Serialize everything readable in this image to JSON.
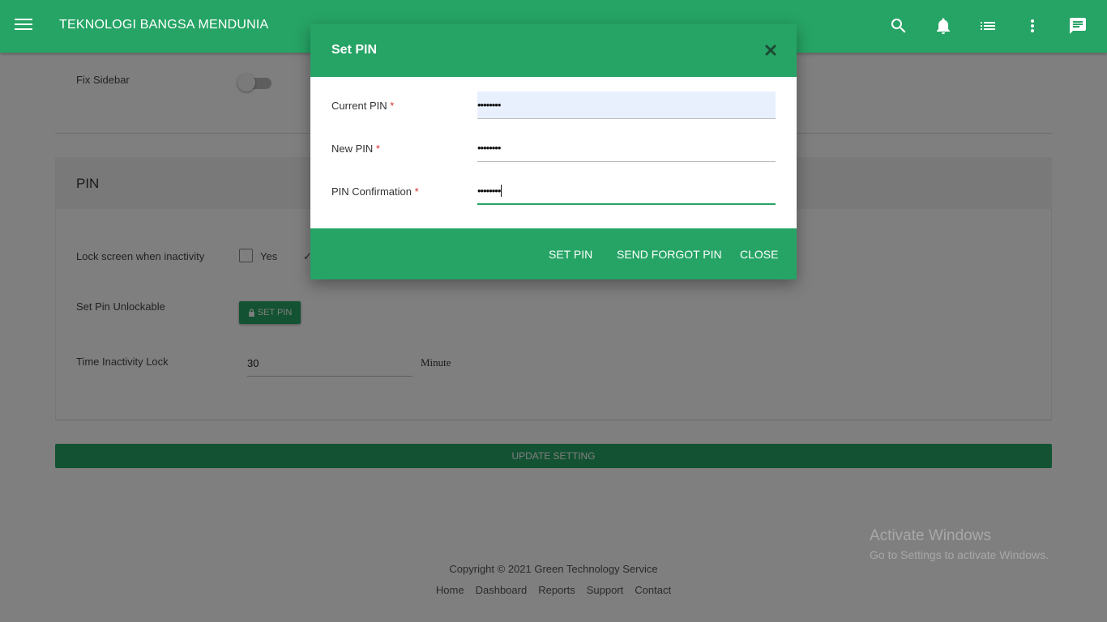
{
  "topbar": {
    "brand": "TEKNOLOGI BANGSA MENDUNIA",
    "icons": [
      "menu-icon",
      "search-icon",
      "bell-icon",
      "list-icon",
      "more-vert-icon",
      "chat-icon"
    ]
  },
  "settings": {
    "fix_sidebar_label": "Fix Sidebar",
    "pin_section_title": "PIN",
    "lock_label": "Lock screen when inactivity",
    "lock_yes_label": "Yes",
    "set_pin_unlockable_label": "Set Pin Unlockable",
    "set_pin_button": "SET PIN",
    "time_inactivity_label": "Time Inactivity Lock",
    "time_inactivity_value": "30",
    "time_unit": "Minute",
    "update_button": "UPDATE SETTING"
  },
  "modal": {
    "title": "Set PIN",
    "fields": [
      {
        "label": "Current PIN",
        "value": "••••••••"
      },
      {
        "label": "New PIN",
        "value": "••••••••"
      },
      {
        "label": "PIN Confirmation",
        "value": "••••••••"
      }
    ],
    "required_mark": "*",
    "buttons": {
      "set_pin": "SET PIN",
      "send_forgot": "SEND FORGOT PIN",
      "close": "CLOSE"
    }
  },
  "footer": {
    "copyright": "Copyright © 2021 Green Technology Service",
    "links": [
      "Home",
      "Dashboard",
      "Reports",
      "Support",
      "Contact"
    ]
  },
  "watermark": {
    "line1": "Activate Windows",
    "line2": "Go to Settings to activate Windows."
  },
  "colors": {
    "primary": "#26a465",
    "overlay": "rgba(0,0,0,0.5)",
    "required": "#d32f2f"
  }
}
